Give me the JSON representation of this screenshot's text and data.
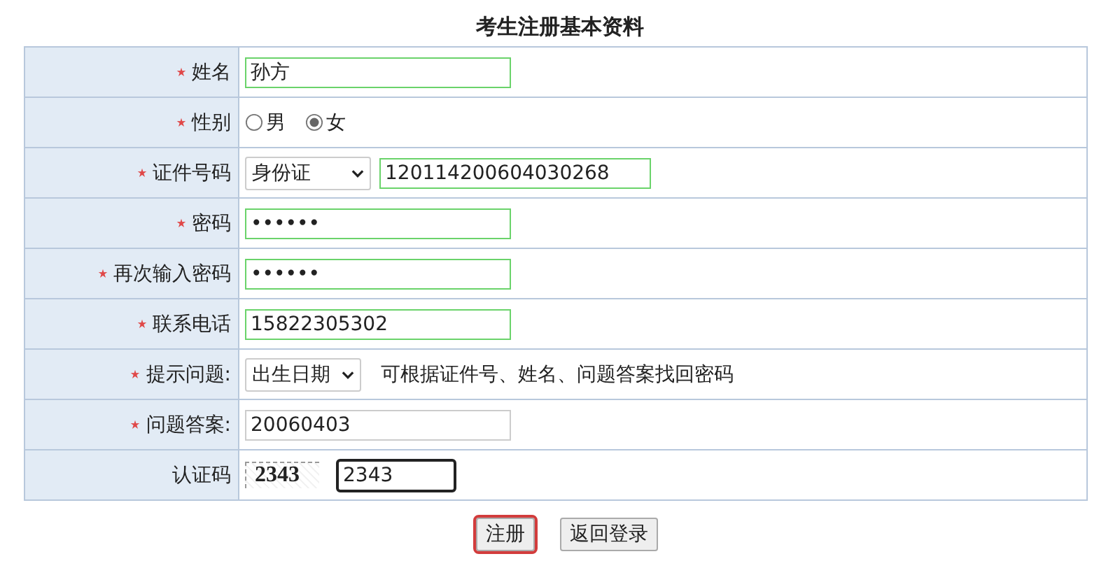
{
  "title": "考生注册基本资料",
  "rows": [
    {
      "kind": "text",
      "required": true,
      "label": "姓名",
      "value": "孙方",
      "valid": true
    },
    {
      "kind": "radio",
      "required": true,
      "label": "性别",
      "options": [
        {
          "label": "男",
          "selected": false
        },
        {
          "label": "女",
          "selected": true
        }
      ]
    },
    {
      "kind": "id",
      "required": true,
      "label": "证件号码",
      "select": "身份证",
      "value": "120114200604030268",
      "valid": true
    },
    {
      "kind": "text",
      "required": true,
      "label": "密码",
      "value": "••••••",
      "valid": true
    },
    {
      "kind": "text",
      "required": true,
      "label": "再次输入密码",
      "value": "••••••",
      "valid": true
    },
    {
      "kind": "text",
      "required": true,
      "label": "联系电话",
      "value": "15822305302",
      "valid": true
    },
    {
      "kind": "select",
      "required": true,
      "label": "提示问题:",
      "select": "出生日期",
      "note": "可根据证件号、姓名、问题答案找回密码"
    },
    {
      "kind": "text",
      "required": true,
      "label": "问题答案:",
      "value": "20060403",
      "valid": false
    },
    {
      "kind": "captcha",
      "required": false,
      "label": "认证码",
      "code": "2343",
      "value": "2343",
      "focused": true
    }
  ],
  "buttons": [
    {
      "label": "注册",
      "focused": true
    },
    {
      "label": "返回登录",
      "focused": false
    }
  ]
}
